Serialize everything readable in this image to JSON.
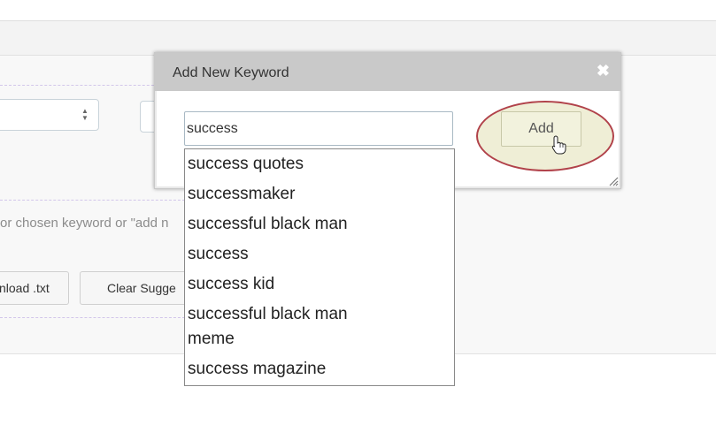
{
  "background": {
    "hint_text": "or chosen keyword or \"add n",
    "download_label": "nload .txt",
    "clear_label": "Clear Sugge"
  },
  "dialog": {
    "title": "Add New Keyword",
    "close_glyph": "✖",
    "input_value": "success",
    "add_label": "Add"
  },
  "suggestions": [
    "success quotes",
    "successmaker",
    "successful black man",
    "success",
    "success kid",
    "successful black man meme",
    "success magazine"
  ],
  "icons": [
    "select-arrows-icon",
    "close-icon",
    "resize-handle-icon",
    "hand-pointer-icon"
  ],
  "colors": {
    "highlight_ring": "#b1424a",
    "highlight_fill": "#efeed6",
    "dialog_header": "#c9c9c9"
  }
}
